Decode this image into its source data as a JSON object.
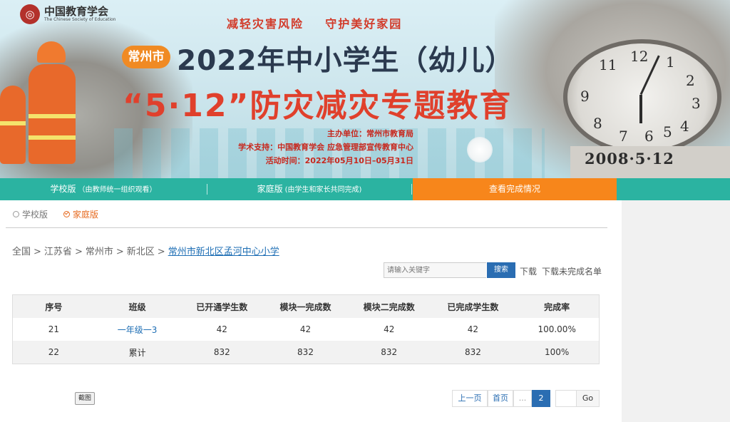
{
  "banner": {
    "logo_cn": "中国教育学会",
    "logo_en": "The Chinese Society of Education",
    "slogan": "减轻灾害风险    守护美好家园",
    "city_pill": "常州市",
    "title_line1": "2022年中小学生（幼儿）",
    "title_line2": "“5·12”防灾减灾专题教育",
    "organizer": "主办单位：常州市教育局",
    "support": "学术支持：中国教育学会 应急管理部宣传教育中心",
    "period": "活动时间：2022年05月10日–05月31日",
    "date_stone": "2008·5·12",
    "clock_numbers": [
      "11",
      "12",
      "1",
      "2",
      "9",
      "3",
      "8",
      "4",
      "7",
      "6",
      "5"
    ]
  },
  "nav": {
    "items": [
      {
        "label": "学校版",
        "sub": "（由教师统一组织观看）"
      },
      {
        "label": "家庭版",
        "sub": "(由学生和家长共同完成)"
      },
      {
        "label": "查看完成情况",
        "sub": ""
      }
    ]
  },
  "filters": {
    "options": [
      "学校版",
      "家庭版"
    ],
    "selected": "家庭版"
  },
  "breadcrumb": {
    "items": [
      "全国",
      "江苏省",
      "常州市",
      "新北区"
    ],
    "current": "常州市新北区孟河中心小学",
    "separator": ">"
  },
  "search": {
    "placeholder": "请输入关键字",
    "button": "搜索",
    "download": "下载",
    "download_incomplete": "下载未完成名单"
  },
  "table": {
    "headers": [
      "序号",
      "班级",
      "已开通学生数",
      "模块一完成数",
      "模块二完成数",
      "已完成学生数",
      "完成率"
    ],
    "rows": [
      [
        "21",
        "一年级一3",
        "42",
        "42",
        "42",
        "42",
        "100.00%"
      ],
      [
        "22",
        "累计",
        "832",
        "832",
        "832",
        "832",
        "100%"
      ]
    ]
  },
  "screenshot_button": "截图",
  "pagination": {
    "prev": "上一页",
    "first": "首页",
    "ellipsis": "...",
    "current": "2",
    "go": "Go"
  },
  "colors": {
    "nav_green": "#2bb3a1",
    "nav_active_orange": "#f7861b",
    "link_blue": "#1f6fb5",
    "button_blue": "#2a6db2",
    "title_red": "#e0402c"
  }
}
